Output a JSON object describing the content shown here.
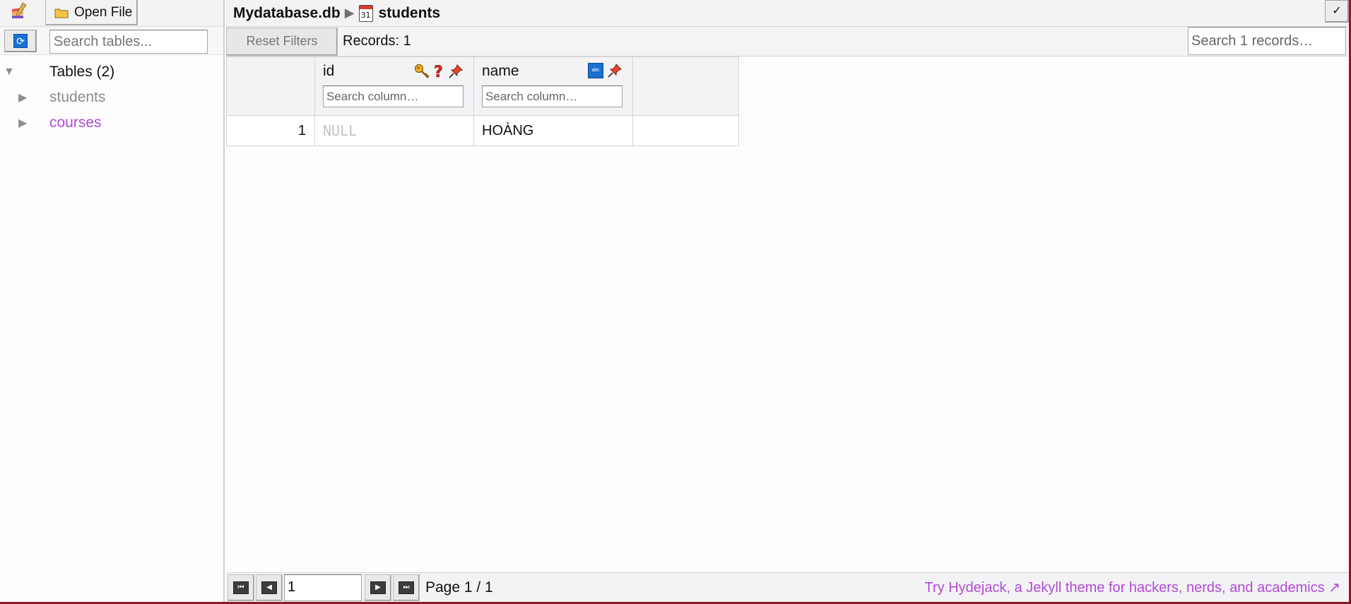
{
  "sidebar": {
    "open_file_label": "Open File",
    "search_placeholder": "Search tables...",
    "tree": {
      "root_label": "Tables (2)",
      "items": [
        {
          "label": "students"
        },
        {
          "label": "courses"
        }
      ]
    }
  },
  "header": {
    "database_name": "Mydatabase.db",
    "table_name": "students",
    "calendar_day": "31",
    "corner_button": "✓"
  },
  "toolbar": {
    "reset_filters_label": "Reset Filters",
    "records_label": "Records: 1",
    "search_records_placeholder": "Search 1 records…"
  },
  "grid": {
    "columns": [
      {
        "name": "id",
        "search_placeholder": "Search column…",
        "icons": [
          "key-icon",
          "question-icon",
          "pin-icon"
        ]
      },
      {
        "name": "name",
        "search_placeholder": "Search column…",
        "icons": [
          "text-type-icon",
          "pin-icon"
        ]
      }
    ],
    "rows": [
      {
        "row_number": "1",
        "id": "NULL",
        "name": "HOÀNG"
      }
    ]
  },
  "pager": {
    "page_value": "1",
    "page_label": "Page 1 / 1",
    "promo_text": "Try Hydejack, a Jekyll theme for hackers, nerds, and academics ↗"
  },
  "colors": {
    "accent_purple": "#b14ad6",
    "window_border": "#8a1a22",
    "refresh_blue": "#1872d9"
  }
}
